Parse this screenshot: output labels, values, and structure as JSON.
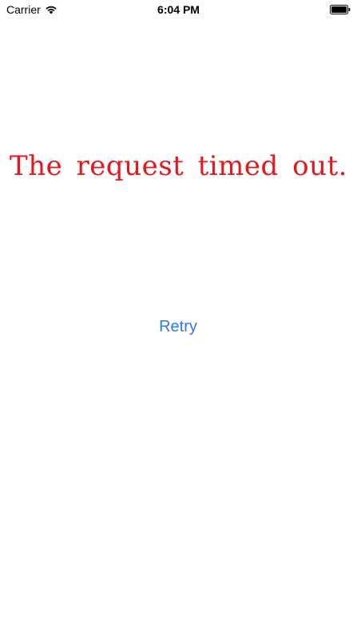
{
  "status_bar": {
    "carrier": "Carrier",
    "time": "6:04 PM",
    "wifi_icon": "wifi-icon",
    "battery_icon": "battery-full-icon"
  },
  "main": {
    "error_message": "The request timed out.",
    "retry_label": "Retry"
  },
  "colors": {
    "error_text": "#e8151b",
    "link": "#2f7ae5",
    "background": "#ffffff"
  }
}
